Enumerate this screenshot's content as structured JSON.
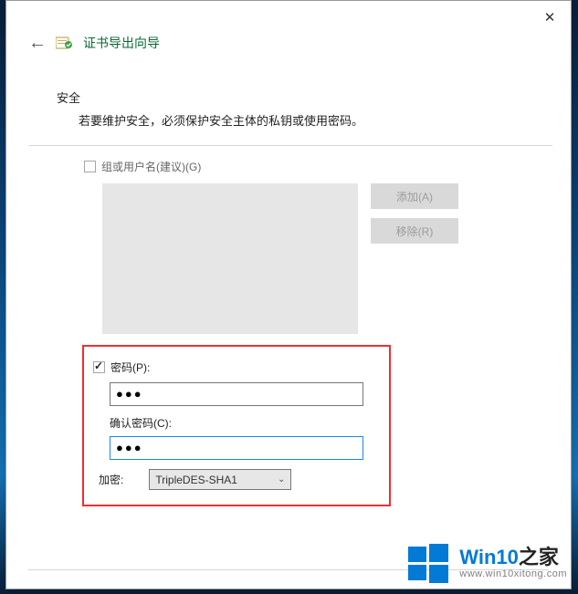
{
  "titlebar": {
    "close_tooltip": "关闭"
  },
  "header": {
    "title": "证书导出向导"
  },
  "security": {
    "heading": "安全",
    "description": "若要维护安全，必须保护安全主体的私钥或使用密码。"
  },
  "group": {
    "checkbox_label": "组或用户名(建议)(G)",
    "add_btn": "添加(A)",
    "remove_btn": "移除(R)"
  },
  "password": {
    "checkbox_label": "密码(P):",
    "checked": true,
    "value": "●●●",
    "confirm_label": "确认密码(C):",
    "confirm_value": "●●●"
  },
  "encryption": {
    "label": "加密:",
    "selected": "TripleDES-SHA1"
  },
  "watermark": {
    "brand_prefix": "Win10",
    "brand_suffix": "之家",
    "url": "www.win10xitong.com"
  }
}
